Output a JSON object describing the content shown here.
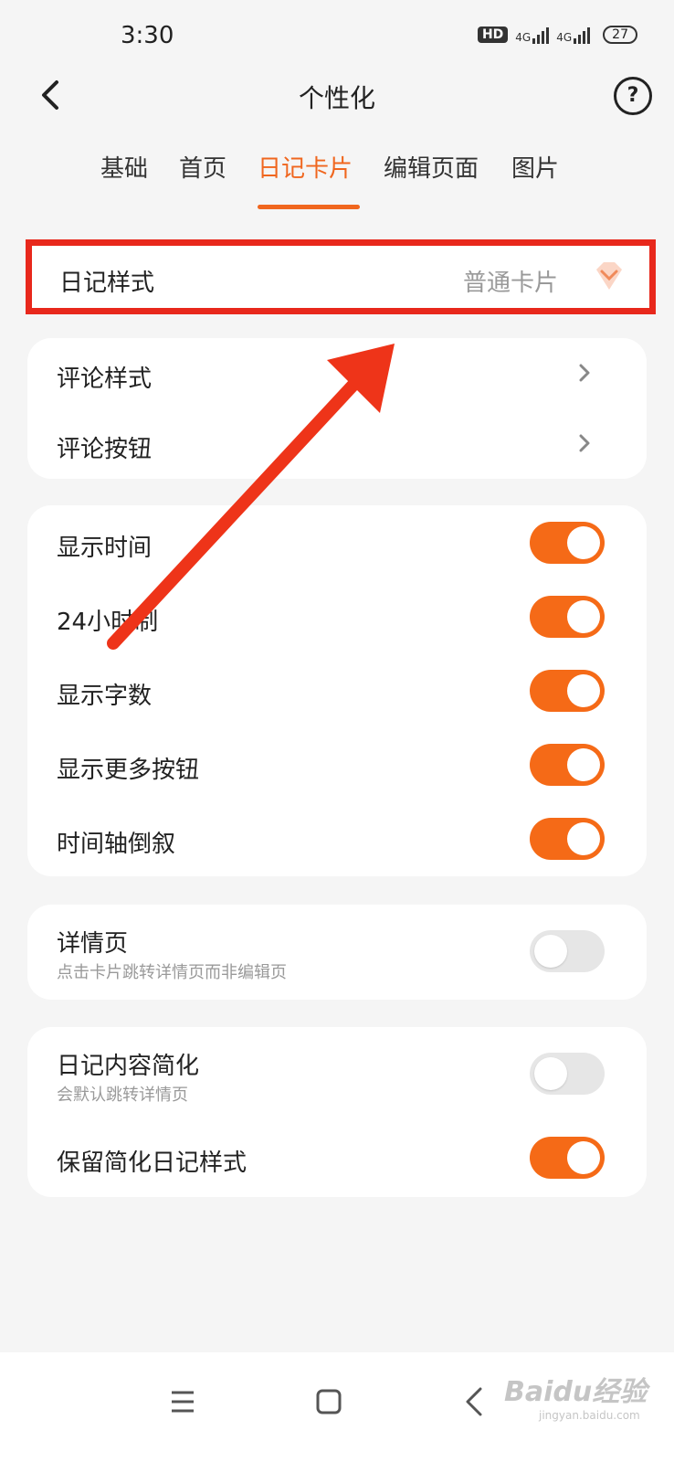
{
  "status": {
    "time": "3:30",
    "hd": "HD",
    "net1": "4G",
    "net2": "4G",
    "battery": "27"
  },
  "header": {
    "title": "个性化",
    "help": "?"
  },
  "tabs": [
    {
      "label": "基础",
      "active": false
    },
    {
      "label": "首页",
      "active": false
    },
    {
      "label": "日记卡片",
      "active": true
    },
    {
      "label": "编辑页面",
      "active": false
    },
    {
      "label": "图片",
      "active": false
    }
  ],
  "diary_style": {
    "label": "日记样式",
    "value": "普通卡片"
  },
  "comment_group": [
    {
      "label": "评论样式"
    },
    {
      "label": "评论按钮"
    }
  ],
  "display_group": [
    {
      "label": "显示时间",
      "on": true
    },
    {
      "label": "24小时制",
      "on": true
    },
    {
      "label": "显示字数",
      "on": true
    },
    {
      "label": "显示更多按钮",
      "on": true
    },
    {
      "label": "时间轴倒叙",
      "on": true
    }
  ],
  "detail_group": {
    "label": "详情页",
    "sub": "点击卡片跳转详情页而非编辑页",
    "on": false
  },
  "simplify_group": [
    {
      "label": "日记内容简化",
      "sub": "会默认跳转详情页",
      "on": false
    },
    {
      "label": "保留简化日记样式",
      "on": true
    }
  ],
  "watermark": {
    "brand": "Baidu经验",
    "url": "jingyan.baidu.com"
  },
  "colors": {
    "accent": "#f56a17",
    "highlight": "#e8281c",
    "background": "#f5f5f5"
  }
}
